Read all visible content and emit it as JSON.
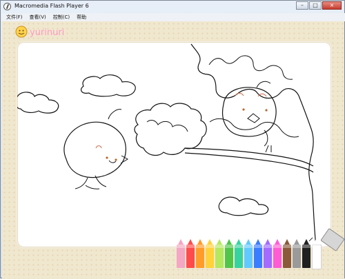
{
  "window": {
    "title": "Macromedia Flash Player 6",
    "controls": {
      "minimize": "–",
      "maximize": "□",
      "close": "×"
    }
  },
  "menu": {
    "items": [
      "文件(F)",
      "查看(V)",
      "控制(C)",
      "帮助"
    ]
  },
  "brand": {
    "logo_text": "yurinuri"
  },
  "colors": {
    "title_bg": "#dce6f1",
    "paper": "#ffffff",
    "background_pattern": "#f0e7cf"
  },
  "pencils": [
    {
      "name": "pink",
      "color": "#f4a6c2"
    },
    {
      "name": "red",
      "color": "#ff4b4b"
    },
    {
      "name": "orange",
      "color": "#ff9c2a"
    },
    {
      "name": "yellow",
      "color": "#ffd23a"
    },
    {
      "name": "light-green",
      "color": "#b4e85f"
    },
    {
      "name": "green",
      "color": "#4fc64a"
    },
    {
      "name": "teal",
      "color": "#36d3a1"
    },
    {
      "name": "sky",
      "color": "#61c9ff"
    },
    {
      "name": "blue",
      "color": "#3b7dff"
    },
    {
      "name": "purple",
      "color": "#a36bff"
    },
    {
      "name": "magenta",
      "color": "#ff5bd6"
    },
    {
      "name": "brown",
      "color": "#8a5a3b"
    },
    {
      "name": "gray",
      "color": "#9a9a9a"
    },
    {
      "name": "black",
      "color": "#202020"
    },
    {
      "name": "white",
      "color": "#ffffff"
    }
  ]
}
